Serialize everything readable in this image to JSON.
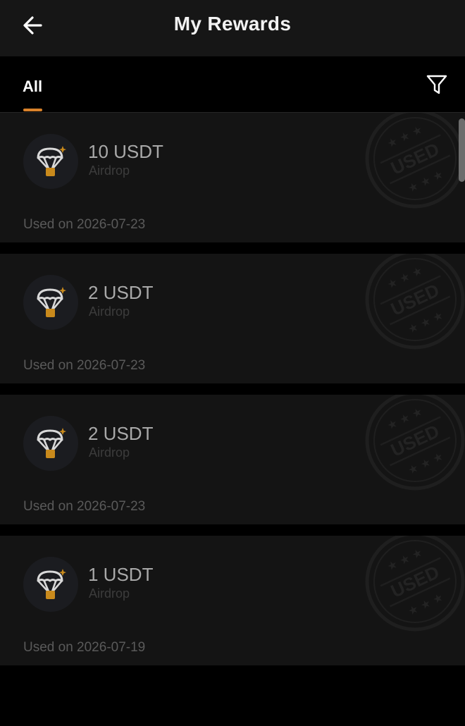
{
  "header": {
    "title": "My Rewards",
    "back_icon": "arrow-left-icon"
  },
  "tabs": {
    "active": "All",
    "items": [
      {
        "label": "All"
      }
    ],
    "filter_icon": "filter-icon",
    "accent_color": "#d9822b"
  },
  "rewards": [
    {
      "amount": "10 USDT",
      "type": "Airdrop",
      "used_text": "Used on 2026-07-23",
      "stamp": "USED",
      "icon": "parachute-icon"
    },
    {
      "amount": "2 USDT",
      "type": "Airdrop",
      "used_text": "Used on 2026-07-23",
      "stamp": "USED",
      "icon": "parachute-icon"
    },
    {
      "amount": "2 USDT",
      "type": "Airdrop",
      "used_text": "Used on 2026-07-23",
      "stamp": "USED",
      "icon": "parachute-icon"
    },
    {
      "amount": "1 USDT",
      "type": "Airdrop",
      "used_text": "Used on 2026-07-19",
      "stamp": "USED",
      "icon": "parachute-icon"
    }
  ]
}
